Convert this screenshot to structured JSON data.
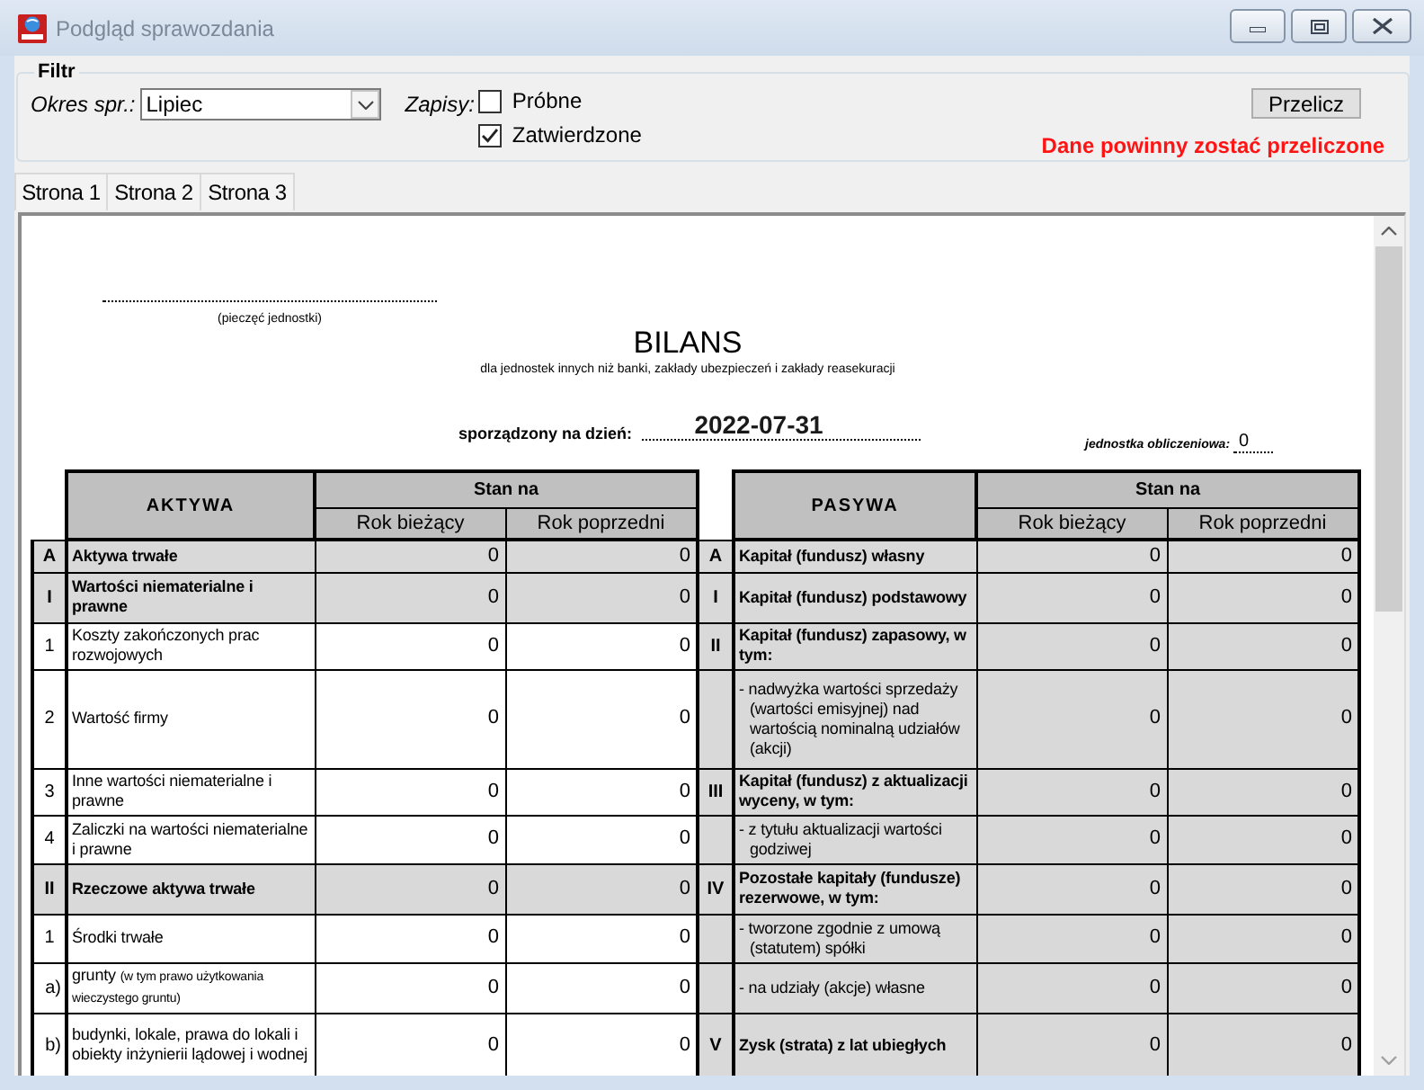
{
  "window": {
    "title": "Podgląd sprawozdania"
  },
  "filter": {
    "title": "Filtr",
    "period": {
      "label": "Okres spr.:",
      "value": "Lipiec"
    },
    "records": {
      "label": "Zapisy:",
      "options": [
        {
          "label": "Próbne",
          "checked": false
        },
        {
          "label": "Zatwierdzone",
          "checked": true
        }
      ]
    },
    "recalculate_button": "Przelicz",
    "warning": "Dane powinny zostać przeliczone"
  },
  "tabs": [
    "Strona 1",
    "Strona 2",
    "Strona 3"
  ],
  "report": {
    "stamp_caption": "(pieczęć jednostki)",
    "title": "BILANS",
    "subtitle": "dla jednostek innych niż banki, zakłady ubezpieczeń i zakłady reasekuracji",
    "date_label": "sporządzony na dzień:",
    "date": "2022-07-31",
    "unit_label": "jednostka obliczeniowa:",
    "unit": "0",
    "tables": [
      {
        "title": "AKTYWA",
        "group_header": "Stan na",
        "columns": [
          "Rok bieżący",
          "Rok poprzedni"
        ],
        "rows": [
          {
            "index": "A",
            "label": "Aktywa trwałe",
            "kind": "section",
            "shaded": true,
            "current": "0",
            "previous": "0"
          },
          {
            "index": "I",
            "label": "Wartości niematerialne i prawne",
            "kind": "section",
            "shaded": true,
            "current": "0",
            "previous": "0"
          },
          {
            "index": "1",
            "label": "Koszty zakończonych prac rozwojowych",
            "kind": "item",
            "shaded": false,
            "current": "0",
            "previous": "0"
          },
          {
            "index": "2",
            "label": "Wartość firmy",
            "kind": "item",
            "shaded": false,
            "current": "0",
            "previous": "0"
          },
          {
            "index": "3",
            "label": "Inne wartości niematerialne i prawne",
            "kind": "item",
            "shaded": false,
            "current": "0",
            "previous": "0"
          },
          {
            "index": "4",
            "label": "Zaliczki na wartości niematerialne i prawne",
            "kind": "item",
            "shaded": false,
            "current": "0",
            "previous": "0"
          },
          {
            "index": "II",
            "label": "Rzeczowe aktywa trwałe",
            "kind": "section",
            "shaded": true,
            "current": "0",
            "previous": "0"
          },
          {
            "index": "1",
            "label": "Środki trwałe",
            "kind": "item",
            "shaded": false,
            "current": "0",
            "previous": "0"
          },
          {
            "index": "a)",
            "label": "grunty",
            "note": "(w tym prawo użytkowania wieczystego gruntu)",
            "kind": "subitem",
            "shaded": false,
            "current": "0",
            "previous": "0"
          },
          {
            "index": "b)",
            "label": "budynki, lokale, prawa do lokali i obiekty inżynierii lądowej i wodnej",
            "kind": "subitem",
            "shaded": false,
            "current": "0",
            "previous": "0"
          }
        ]
      },
      {
        "title": "PASYWA",
        "group_header": "Stan na",
        "columns": [
          "Rok bieżący",
          "Rok poprzedni"
        ],
        "rows": [
          {
            "index": "A",
            "label": "Kapitał (fundusz) własny",
            "kind": "section",
            "shaded": true,
            "current": "0",
            "previous": "0"
          },
          {
            "index": "I",
            "label": "Kapitał (fundusz) podstawowy",
            "kind": "section",
            "shaded": true,
            "current": "0",
            "previous": "0"
          },
          {
            "index": "II",
            "label": "Kapitał (fundusz) zapasowy, w tym:",
            "kind": "section",
            "shaded": true,
            "current": "0",
            "previous": "0"
          },
          {
            "label": "- nadwyżka wartości sprzedaży (wartości emisyjnej) nad wartością nominalną udziałów (akcji)",
            "kind": "detail",
            "shaded": true,
            "current": "0",
            "previous": "0"
          },
          {
            "index": "III",
            "label": "Kapitał (fundusz) z aktualizacji wyceny, w tym:",
            "kind": "section",
            "shaded": true,
            "current": "0",
            "previous": "0"
          },
          {
            "label": "- z tytułu aktualizacji wartości godziwej",
            "kind": "detail",
            "shaded": true,
            "current": "0",
            "previous": "0"
          },
          {
            "index": "IV",
            "label": "Pozostałe kapitały (fundusze) rezerwowe, w tym:",
            "kind": "section",
            "shaded": true,
            "current": "0",
            "previous": "0"
          },
          {
            "label": "- tworzone zgodnie z umową (statutem) spółki",
            "kind": "detail",
            "shaded": true,
            "current": "0",
            "previous": "0"
          },
          {
            "label": "- na udziały (akcje) własne",
            "kind": "detail",
            "shaded": true,
            "current": "0",
            "previous": "0"
          },
          {
            "index": "V",
            "label": "Zysk (strata) z lat ubiegłych",
            "kind": "section",
            "shaded": true,
            "current": "0",
            "previous": "0"
          }
        ]
      }
    ]
  }
}
